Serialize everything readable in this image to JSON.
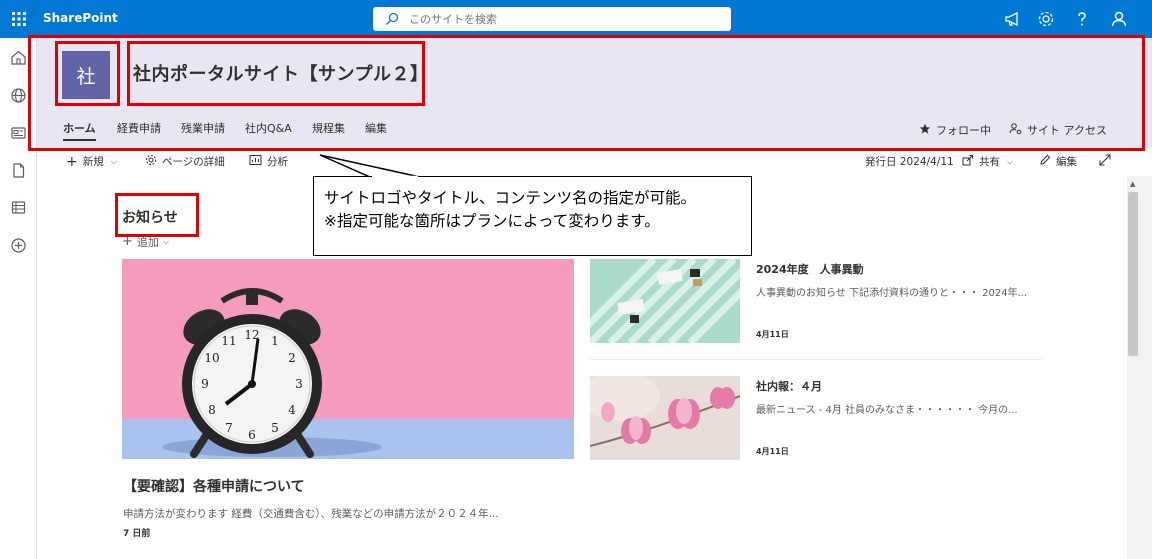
{
  "suitebar": {
    "brand": "SharePoint",
    "search_placeholder": "このサイトを検索"
  },
  "site": {
    "logo_text": "社",
    "title": "社内ポータルサイト【サンプル２】",
    "nav": [
      "ホーム",
      "経費申請",
      "残業申請",
      "社内Q&A",
      "規程集",
      "編集"
    ],
    "follow": "フォロー中",
    "site_access": "サイト アクセス"
  },
  "command_bar": {
    "new": "新規",
    "page_details": "ページの詳細",
    "analytics": "分析",
    "published": "発行日 2024/4/11",
    "share": "共有",
    "edit": "編集"
  },
  "news": {
    "section_title": "お知らせ",
    "add": "追加",
    "hero": {
      "title": "【要確認】各種申請について",
      "description": "申請方法が変わります 経費（交通費含む）、残業などの申請方法が２０２４年...",
      "date": "7 日前"
    },
    "items": [
      {
        "title": "2024年度　人事異動",
        "description": "人事異動のお知らせ 下記添付資料の通りと・・・ 2024年...",
        "date": "4月11日"
      },
      {
        "title": "社内報：４月",
        "description": "最新ニュース - 4月 社員のみなさま・・・・・・ 今月の...",
        "date": "4月11日"
      }
    ]
  },
  "callout": {
    "line1": "サイトロゴやタイトル、コンテンツ名の指定が可能。",
    "line2": "※指定可能な箇所はプランによって変わります。"
  },
  "colors": {
    "suitebar": "#0078d4",
    "header_bg": "#e8e6f2",
    "logo_bg": "#6264a7",
    "highlight": "#e00000"
  }
}
